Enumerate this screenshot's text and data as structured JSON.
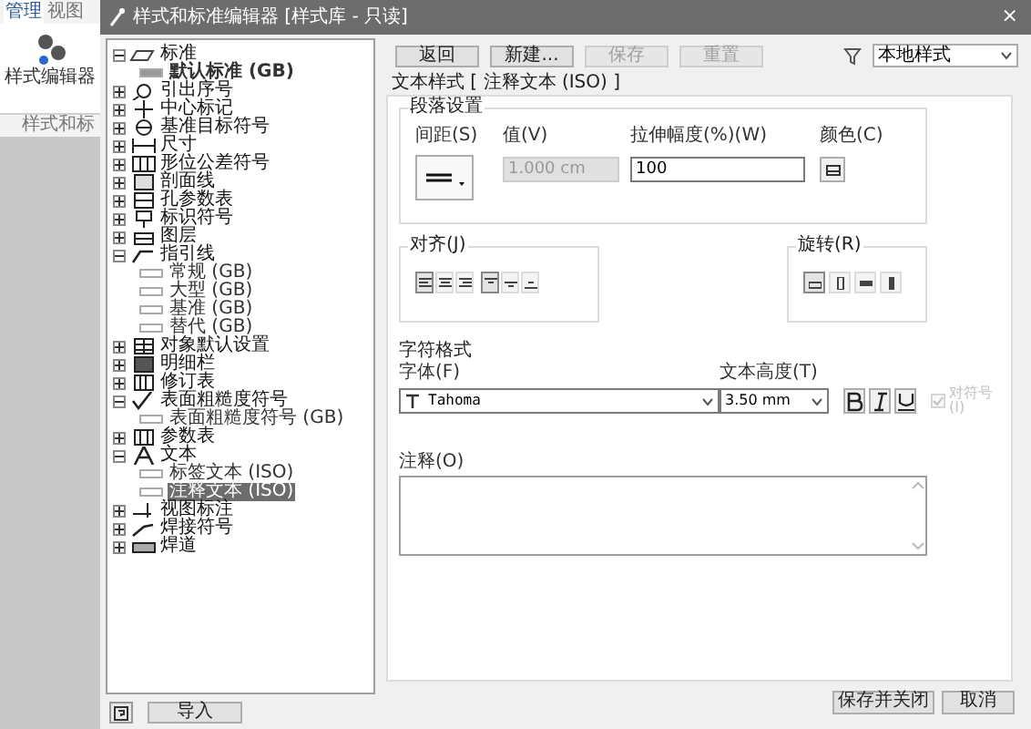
{
  "ribbon": {
    "tabs": [
      {
        "label": "管理",
        "selected": true
      },
      {
        "label": "视图",
        "selected": false
      }
    ],
    "button": "样式编辑器",
    "group": "样式和标"
  },
  "window": {
    "title": "样式和标准编辑器 [样式库 - 只读]",
    "close": "×"
  },
  "tree": [
    {
      "label": "标准",
      "expanded": true,
      "children": [
        {
          "label": "默认标准 (GB)",
          "selected": false,
          "active": true
        }
      ]
    },
    {
      "label": "引出序号",
      "expanded": false
    },
    {
      "label": "中心标记",
      "expanded": false
    },
    {
      "label": "基准目标符号",
      "expanded": false
    },
    {
      "label": "尺寸",
      "expanded": false
    },
    {
      "label": "形位公差符号",
      "expanded": false
    },
    {
      "label": "剖面线",
      "expanded": false
    },
    {
      "label": "孔参数表",
      "expanded": false
    },
    {
      "label": "标识符号",
      "expanded": false
    },
    {
      "label": "图层",
      "expanded": false
    },
    {
      "label": "指引线",
      "expanded": true,
      "children": [
        {
          "label": "常规 (GB)",
          "selected": false,
          "active": false
        },
        {
          "label": "大型 (GB)",
          "selected": false,
          "active": false
        },
        {
          "label": "基准 (GB)",
          "selected": false,
          "active": false
        },
        {
          "label": "替代 (GB)",
          "selected": false,
          "active": false
        }
      ]
    },
    {
      "label": "对象默认设置",
      "expanded": false
    },
    {
      "label": "明细栏",
      "expanded": false
    },
    {
      "label": "修订表",
      "expanded": false
    },
    {
      "label": "表面粗糙度符号",
      "expanded": true,
      "children": [
        {
          "label": "表面粗糙度符号 (GB)",
          "selected": false,
          "active": false
        }
      ]
    },
    {
      "label": "参数表",
      "expanded": false
    },
    {
      "label": "文本",
      "expanded": true,
      "children": [
        {
          "label": "标签文本 (ISO)",
          "selected": false,
          "active": false
        },
        {
          "label": "注释文本 (ISO)",
          "selected": true,
          "active": false
        }
      ]
    },
    {
      "label": "视图标注",
      "expanded": false
    },
    {
      "label": "焊接符号",
      "expanded": false
    },
    {
      "label": "焊道",
      "expanded": false
    }
  ],
  "toolbar": [
    {
      "label": "返回",
      "disabled": false
    },
    {
      "label": "新建...",
      "disabled": false
    },
    {
      "label": "保存",
      "disabled": true
    },
    {
      "label": "重置",
      "disabled": true
    }
  ],
  "filter": {
    "value": "本地样式"
  },
  "style_heading": "文本样式 [ 注释文本 (ISO) ]",
  "paragraph": {
    "title": "段落设置",
    "spacing_label": "间距(S)",
    "value_label": "值(V)",
    "value": "1.000 cm",
    "value_disabled": true,
    "stretch_label": "拉伸幅度(%)(W)",
    "stretch": "100",
    "color_label": "颜色(C)"
  },
  "justification": {
    "title": "对齐(J)",
    "horizontal": [
      {
        "selected": true
      },
      {
        "selected": false
      },
      {
        "selected": false
      }
    ],
    "vertical": [
      {
        "selected": true
      },
      {
        "selected": false
      },
      {
        "selected": false
      }
    ]
  },
  "rotation": {
    "title": "旋转(R)",
    "options": [
      {
        "selected": true
      },
      {
        "selected": false
      },
      {
        "selected": false
      },
      {
        "selected": false
      }
    ]
  },
  "character": {
    "title": "字符格式",
    "font_label": "字体(F)",
    "font": "Tahoma",
    "height_label": "文本高度(T)",
    "height": "3.50 mm",
    "bold": false,
    "italic": false,
    "underline": false,
    "symbol_label": "对符号(I)",
    "symbol_checked": true,
    "symbol_disabled": true
  },
  "comment": {
    "label": "注释(O)"
  },
  "footer": {
    "import": "导入",
    "save_close": "保存并关闭",
    "cancel": "取消"
  }
}
